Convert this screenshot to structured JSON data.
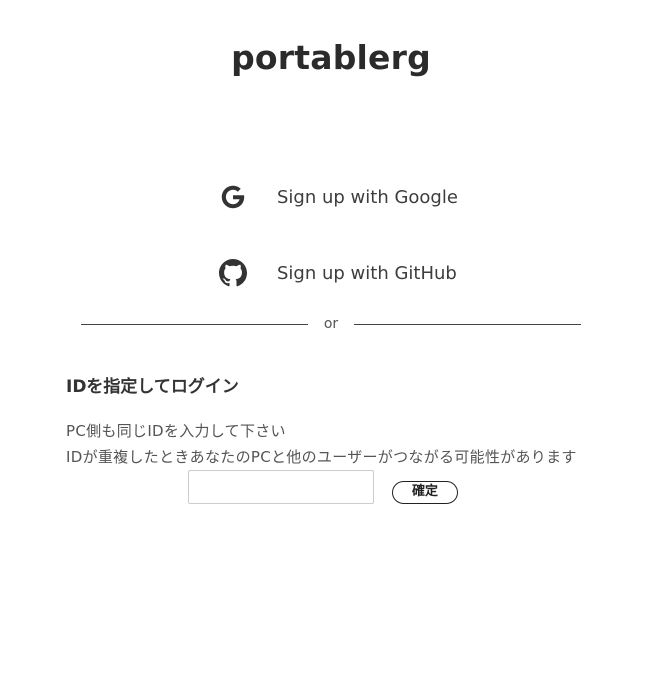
{
  "app": {
    "title": "portablerg"
  },
  "oauth": {
    "google": {
      "label": "Sign up with Google",
      "icon": "google-icon"
    },
    "github": {
      "label": "Sign up with GitHub",
      "icon": "github-icon"
    }
  },
  "divider": {
    "text": "or"
  },
  "id_login": {
    "heading": "IDを指定してログイン",
    "note_line1": "PC側も同じIDを入力して下さい",
    "note_line2": "IDが重複したときあなたのPCと他のユーザーがつながる可能性があります",
    "input_value": "",
    "input_placeholder": "",
    "confirm_label": "確定"
  },
  "colors": {
    "text": "#333333",
    "divider": "#444444",
    "input_border": "#cccccc"
  }
}
